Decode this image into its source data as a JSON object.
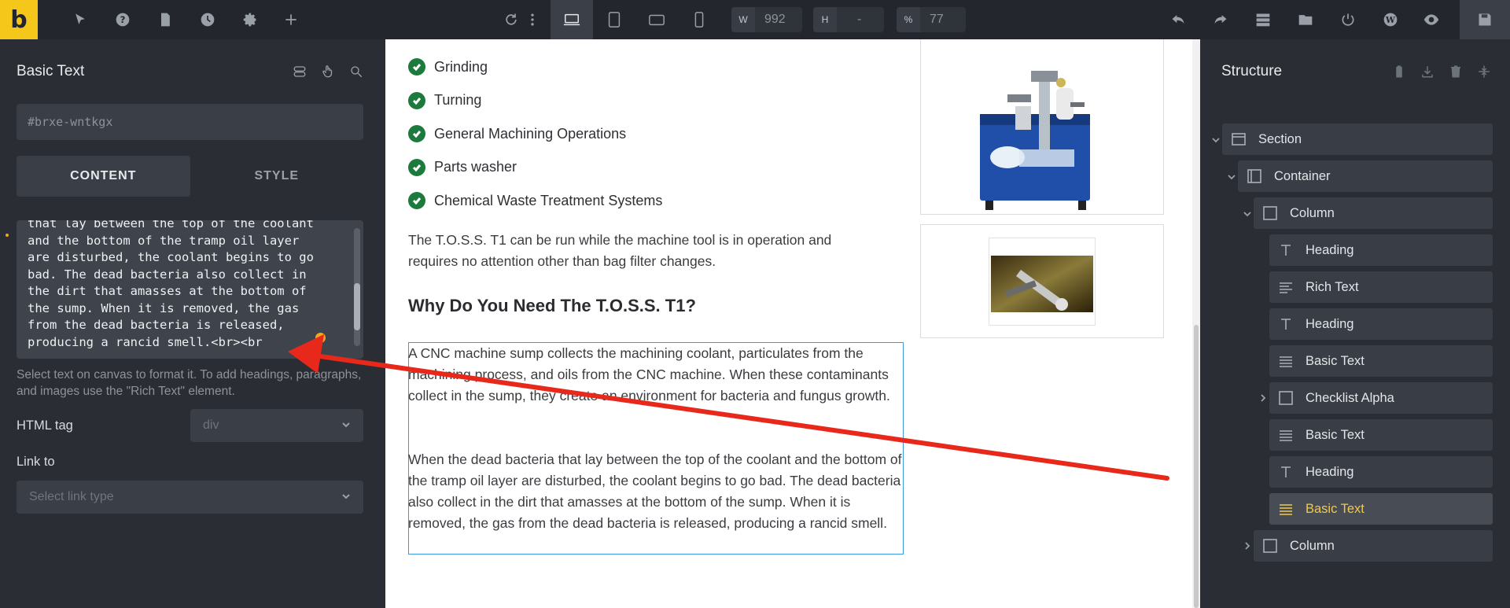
{
  "topbar": {
    "logo": "b",
    "width_label": "W",
    "width_value": "992",
    "height_label": "H",
    "height_value": "-",
    "percent_label": "%",
    "percent_value": "77"
  },
  "left_panel": {
    "title": "Basic Text",
    "element_id": "#brxe-wntkgx",
    "tabs": [
      "CONTENT",
      "STYLE"
    ],
    "textarea_value": "that lay between the top of the coolant\nand the bottom of the tramp oil layer\nare disturbed, the coolant begins to go\nbad. The dead bacteria also collect in\nthe dirt that amasses at the bottom of\nthe sump. When it is removed, the gas\nfrom the dead bacteria is released,\nproducing a rancid smell.<br><br",
    "help_text": "Select text on canvas to format it. To add headings, paragraphs, and images use the \"Rich Text\" element.",
    "html_tag_label": "HTML tag",
    "html_tag_value": "div",
    "link_to_label": "Link to",
    "link_to_placeholder": "Select link type"
  },
  "canvas": {
    "checklist": [
      "Grinding",
      "Turning",
      "General Machining Operations",
      "Parts washer",
      "Chemical Waste Treatment Systems"
    ],
    "intro_paragraph": "The T.O.S.S. T1 can be run while the machine tool is in operation and requires no attention other than bag filter changes.",
    "heading": "Why Do You Need The T.O.S.S. T1?",
    "body_paragraph_1": "A CNC machine sump collects the machining coolant, particulates from the machining process, and oils from the CNC machine. When these contaminants collect in the sump, they create an environment for bacteria and fungus growth.",
    "body_paragraph_2": "When the dead bacteria that lay between the top of the coolant and the bottom of the tramp oil layer are disturbed, the coolant begins to go bad. The dead bacteria also collect in the dirt that amasses at the bottom of the sump. When it is removed, the gas from the dead bacteria is released, producing a rancid smell."
  },
  "structure": {
    "title": "Structure",
    "items": [
      {
        "label": "Section",
        "icon": "section-icon"
      },
      {
        "label": "Container",
        "icon": "container-icon"
      },
      {
        "label": "Column",
        "icon": "column-icon"
      },
      {
        "label": "Heading",
        "icon": "heading-icon"
      },
      {
        "label": "Rich Text",
        "icon": "rich-text-icon"
      },
      {
        "label": "Heading",
        "icon": "heading-icon"
      },
      {
        "label": "Basic Text",
        "icon": "basic-text-icon"
      },
      {
        "label": "Checklist Alpha",
        "icon": "checklist-icon"
      },
      {
        "label": "Basic Text",
        "icon": "basic-text-icon"
      },
      {
        "label": "Heading",
        "icon": "heading-icon"
      },
      {
        "label": "Basic Text",
        "icon": "basic-text-icon"
      },
      {
        "label": "Column",
        "icon": "column-icon"
      }
    ]
  },
  "colors": {
    "accent": "#f5c71a",
    "active_tree_text": "#f2c94c",
    "check_green": "#1b7a3c",
    "selection_blue": "#3a9be0",
    "annotation_red": "#e8281a"
  }
}
